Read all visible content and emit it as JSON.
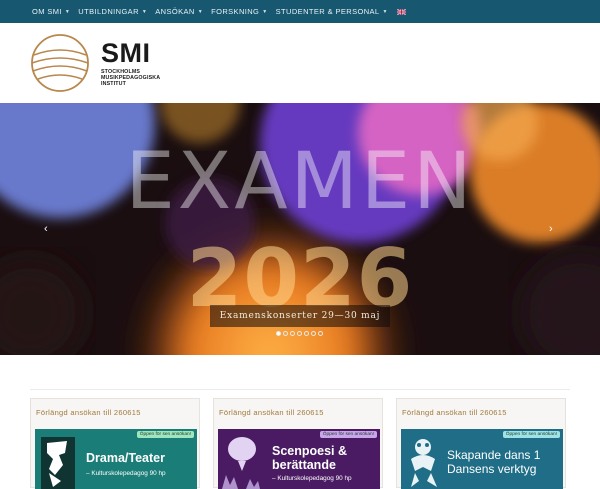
{
  "nav": {
    "items": [
      {
        "label": "OM SMI",
        "caret": "▼"
      },
      {
        "label": "UTBILDNINGAR",
        "caret": "▼"
      },
      {
        "label": "ANSÖKAN",
        "caret": "▼"
      },
      {
        "label": "FORSKNING",
        "caret": "▼"
      },
      {
        "label": "STUDENTER & PERSONAL",
        "caret": "▼"
      }
    ]
  },
  "logo": {
    "name": "SMI",
    "sub_line1": "STOCKHOLMS",
    "sub_line2": "MUSIKPEDAGOGISKA",
    "sub_line3": "INSTITUT"
  },
  "hero": {
    "title": "EXAMEN",
    "year": "2026",
    "caption": "Examenskonserter 29—30 maj",
    "prev": "‹",
    "next": "›",
    "slide_count": 7,
    "active_slide": 0
  },
  "cards": [
    {
      "heading": "Förlängd ansökan till 260615",
      "badge": "Öppen för sen ansökan!",
      "title_line1": "Drama/Teater",
      "title_line2": "",
      "sub": "–  Kulturskolepedagog 90 hp",
      "color": "#1b7d77",
      "badge_color": "#9ee6bd"
    },
    {
      "heading": "Förlängd ansökan till 260615",
      "badge": "Öppen för sen ansökan!",
      "title_line1": "Scenpoesi &",
      "title_line2": "berättande",
      "sub": "–  Kulturskolepedagog 90 hp",
      "color": "#4a1b63",
      "badge_color": "#c9a6ec"
    },
    {
      "heading": "Förlängd ansökan till 260615",
      "badge": "Öppen för sen ansökan!",
      "title_line1": "Skapande dans 1",
      "title_line2": "Dansens verktyg",
      "sub": "",
      "color": "#1f6d86",
      "badge_color": "#9ee2e6"
    }
  ]
}
